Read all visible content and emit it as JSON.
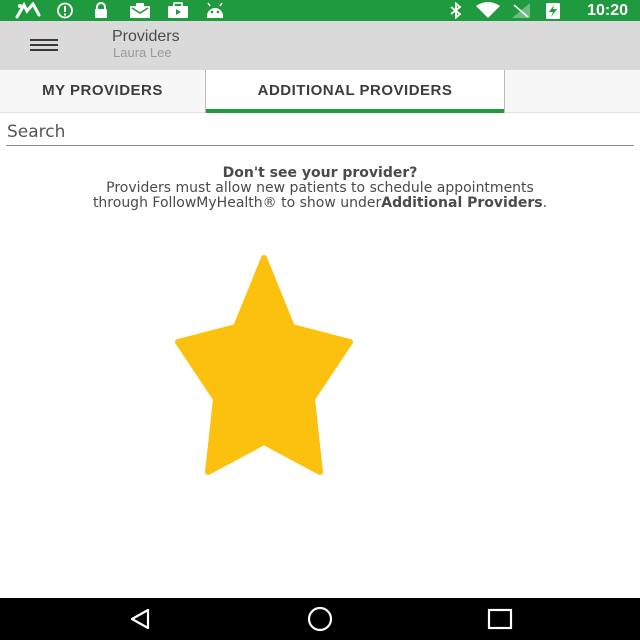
{
  "status_bar": {
    "time": "10:20",
    "left_icons": [
      "signal-icon",
      "info-icon",
      "lock-icon",
      "mail-icon",
      "briefcase-icon",
      "android-icon"
    ],
    "right_icons": [
      "bluetooth-icon",
      "wifi-icon",
      "cell-signal-icon",
      "battery-charging-icon"
    ],
    "background_color": "#1f9a3f"
  },
  "app_bar": {
    "title": "Providers",
    "subtitle": "Laura Lee"
  },
  "tabs": [
    {
      "label": "MY PROVIDERS",
      "selected": false
    },
    {
      "label": "ADDITIONAL PROVIDERS",
      "selected": true
    }
  ],
  "search": {
    "placeholder": "Search",
    "value": ""
  },
  "message": {
    "heading": "Don't see your provider?",
    "line1": "Providers must allow new patients to schedule appointments",
    "line2_prefix": "through FollowMyHealth® to show under",
    "line2_strong": "Additional Providers",
    "line2_suffix": "."
  },
  "illustration": {
    "icon": "star-icon",
    "color": "#fcc10f"
  },
  "nav_bar": {
    "buttons": [
      "back-icon",
      "home-icon",
      "recents-icon"
    ]
  }
}
